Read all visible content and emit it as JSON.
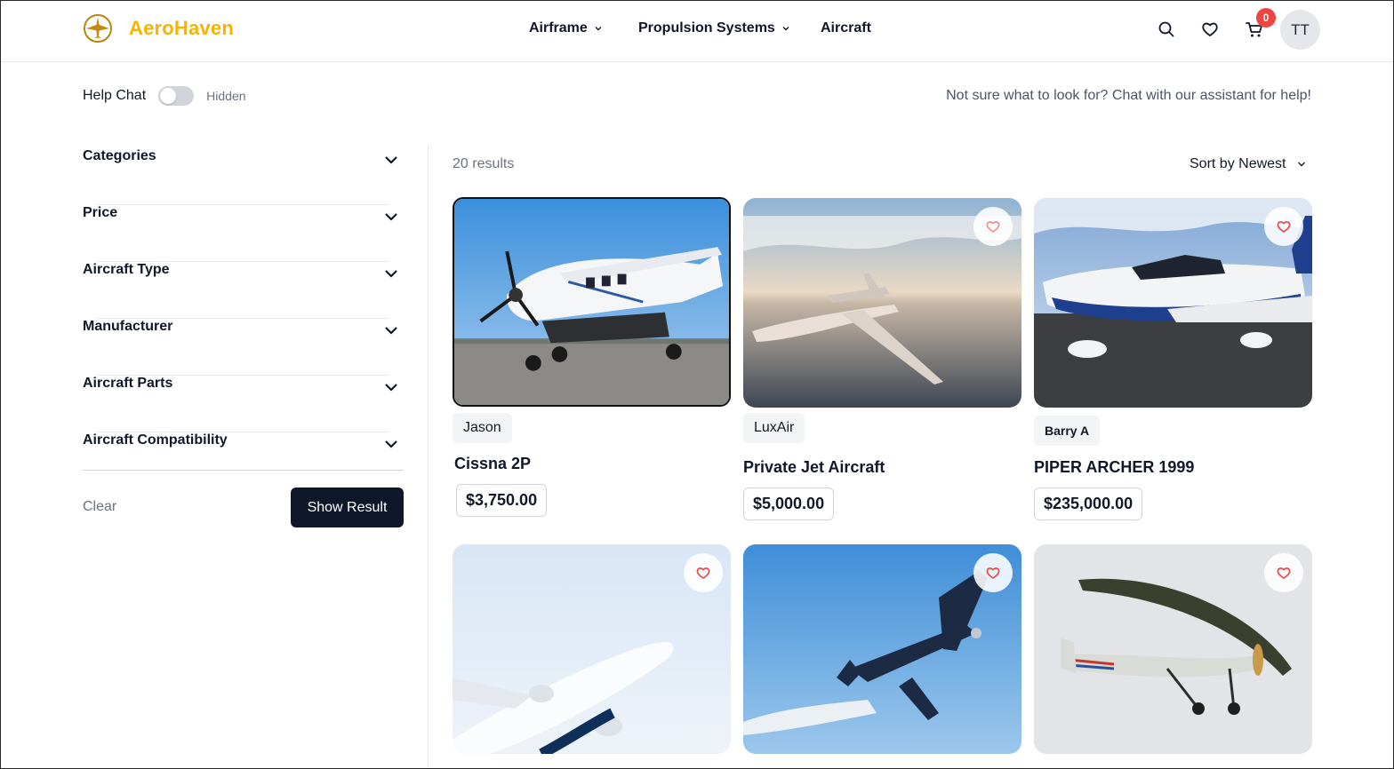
{
  "brand": {
    "name": "AeroHaven",
    "logo_icon": "airplane-compass-logo",
    "color": "#f4b400"
  },
  "nav": {
    "items": [
      {
        "label": "Airframe",
        "has_dropdown": true
      },
      {
        "label": "Propulsion Systems",
        "has_dropdown": true
      },
      {
        "label": "Aircraft",
        "has_dropdown": false
      }
    ]
  },
  "header_actions": {
    "search_icon": "search-icon",
    "wishlist_icon": "heart-icon",
    "cart_icon": "cart-icon",
    "cart_count": "0",
    "avatar_initials": "TT"
  },
  "help_chat": {
    "label": "Help Chat",
    "state": "Hidden",
    "hint": "Not sure what to look for? Chat with our assistant for help!"
  },
  "filters": [
    {
      "label": "Categories"
    },
    {
      "label": "Price"
    },
    {
      "label": "Aircraft Type"
    },
    {
      "label": "Manufacturer"
    },
    {
      "label": "Aircraft Parts"
    },
    {
      "label": "Aircraft Compatibility"
    }
  ],
  "filter_actions": {
    "clear_label": "Clear",
    "show_label": "Show Result"
  },
  "results": {
    "count_label": "20 results",
    "sort_label": "Sort by Newest"
  },
  "listings": [
    {
      "seller": "Jason",
      "title": "Cissna 2P",
      "price": "$3,750.00"
    },
    {
      "seller": "LuxAir",
      "title": "Private Jet Aircraft",
      "price": "$5,000.00"
    },
    {
      "seller": "Barry A",
      "title": "PIPER ARCHER 1999",
      "price": "$235,000.00"
    },
    {
      "seller": "",
      "title": "",
      "price": ""
    },
    {
      "seller": "",
      "title": "",
      "price": ""
    },
    {
      "seller": "",
      "title": "",
      "price": ""
    }
  ],
  "colors": {
    "accent": "#f4b400",
    "primary_button": "#0f172a",
    "badge": "#ef4444",
    "heart": "#ef4444"
  }
}
